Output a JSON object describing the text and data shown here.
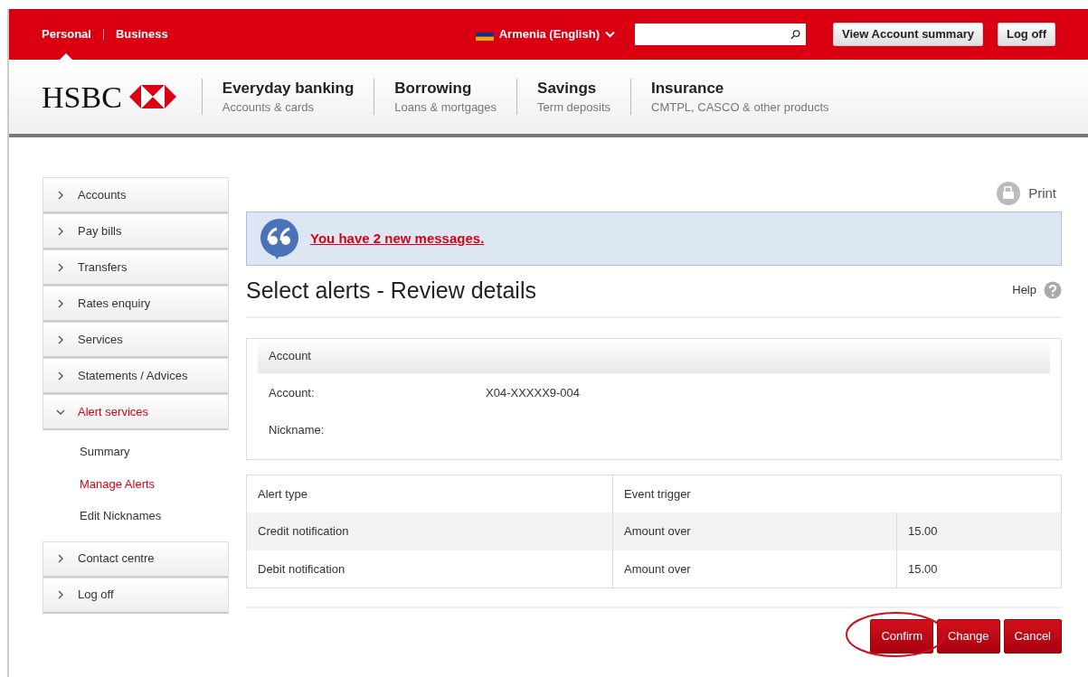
{
  "top_bar": {
    "segments": [
      {
        "label": "Personal",
        "selected": true
      },
      {
        "label": "Business",
        "selected": false
      }
    ],
    "region": {
      "label": "Armenia (English)"
    },
    "buttons": [
      "View Account summary",
      "Log off"
    ]
  },
  "header": {
    "logo": "HSBC",
    "nav": [
      {
        "title": "Everyday banking",
        "subtitle": "Accounts & cards"
      },
      {
        "title": "Borrowing",
        "subtitle": "Loans & mortgages"
      },
      {
        "title": "Savings",
        "subtitle": "Term deposits"
      },
      {
        "title": "Insurance",
        "subtitle": "CMTPL, CASCO & other products"
      }
    ]
  },
  "sidebar": {
    "items": [
      {
        "label": "Accounts",
        "expanded": false
      },
      {
        "label": "Pay bills",
        "expanded": false
      },
      {
        "label": "Transfers",
        "expanded": false
      },
      {
        "label": "Rates enquiry",
        "expanded": false
      },
      {
        "label": "Services",
        "expanded": false
      },
      {
        "label": "Statements / Advices",
        "expanded": false
      },
      {
        "label": "Alert services",
        "expanded": true,
        "children": [
          {
            "label": "Summary",
            "selected": false
          },
          {
            "label": "Manage Alerts",
            "selected": true
          },
          {
            "label": "Edit Nicknames",
            "selected": false
          }
        ]
      },
      {
        "label": "Contact centre",
        "expanded": false
      },
      {
        "label": "Log off",
        "expanded": false
      }
    ]
  },
  "print_link": "Print",
  "messages_link": "You have 2 new messages.",
  "page_title": "Select alerts - Review details",
  "help_link": "Help",
  "account_panel": {
    "heading": "Account",
    "fields": [
      {
        "label": "Account:",
        "value": "X04-XXXXX9-004"
      },
      {
        "label": "Nickname:"
      }
    ]
  },
  "alerts_table": {
    "columns": [
      "Alert type",
      "Event trigger"
    ],
    "rows": [
      [
        "Credit notification",
        "Amount over",
        "15.00"
      ],
      [
        "Debit notification",
        "Amount over",
        "15.00"
      ]
    ]
  },
  "actions": [
    {
      "label": "Confirm",
      "highlighted": true
    },
    {
      "label": "Change",
      "highlighted": false
    },
    {
      "label": "Cancel",
      "highlighted": false
    }
  ]
}
